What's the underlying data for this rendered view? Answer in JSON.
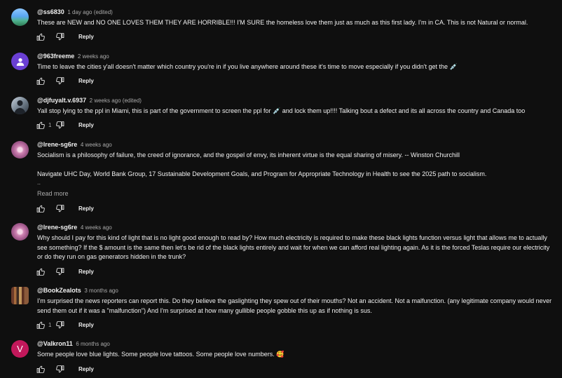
{
  "reply_label": "Reply",
  "read_more_label": "Read more",
  "comments": [
    {
      "handle": "@ss6830",
      "time": "1 day ago (edited)",
      "text": "These are NEW and NO ONE LOVES THEM THEY ARE HORRIBLE!!! I'M SURE the homeless love them just as much as this first lady. I'm in CA. This is not Natural or normal.",
      "likes": ""
    },
    {
      "handle": "@963freeme",
      "time": "2 weeks ago",
      "text": "Time to leave the cities y'all doesn't matter which country you're in if you live anywhere around these it's time to move especially if you didn't get the 💉",
      "likes": ""
    },
    {
      "handle": "@djfuyalt.v.6937",
      "time": "2 weeks ago (edited)",
      "text": "Yall stop lying to the ppl in Miami, this is part of the government to screen the ppl for 💉 and lock them up!!!! Talking bout a defect and its all across the country and Canada too",
      "likes": "1"
    },
    {
      "handle": "@lrene-sg6re",
      "time": "4 weeks ago",
      "text_line1": "Socialism is a philosophy of failure, the creed of ignorance, and the gospel of envy, its inherent virtue is the equal sharing of misery. -- Winston Churchill",
      "text_line2": "Navigate UHC Day, World Bank Group, 17 Sustainable Development Goals, and Program for Appropriate Technology in Health to see the 2025 path to socialism.",
      "text_line3": "..",
      "likes": ""
    },
    {
      "handle": "@lrene-sg6re",
      "time": "4 weeks ago",
      "text": "Why should I pay for this kind of light that is no light good enough to read by?  How much electricity is required to make these black lights function versus light that allows me to actually see something?  If the $ amount is the same then let's be rid of the black lights entirely and wait for when we can afford real lighting again.  As it is the forced Teslas require our electricity or do they run on gas generators hidden in the trunk?",
      "likes": ""
    },
    {
      "handle": "@BookZealots",
      "time": "3 months ago",
      "text": "I'm surprised the news reporters can report this. Do they believe the gaslighting they spew out of their mouths? Not an accident. Not a malfunction. (any legitimate company would never send them out if it was a \"malfunction\") And I'm surprised at how many gullible people gobble this up as if nothing is sus.",
      "likes": "1"
    },
    {
      "handle": "@Valkron11",
      "time": "6 months ago",
      "text": "Some people love blue lights. Some people love tattoos. Some people love numbers. 🥰",
      "likes": "",
      "avatar_letter": "V"
    }
  ]
}
